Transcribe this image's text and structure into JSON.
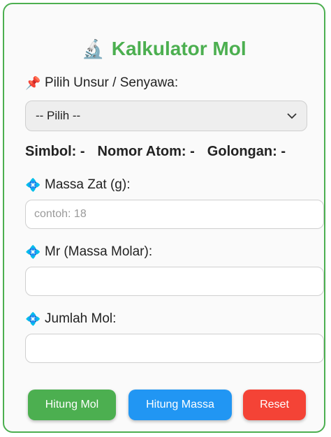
{
  "title": {
    "icon": "microscope-icon",
    "text": "Kalkulator Mol",
    "color": "#4caf50"
  },
  "unsur_label": {
    "icon": "pushpin-icon",
    "text": "Pilih Unsur / Senyawa:"
  },
  "select": {
    "value": "-- Pilih --"
  },
  "info": {
    "simbol": "Simbol: -",
    "nomor_atom": "Nomor Atom: -",
    "golongan": "Golongan: -"
  },
  "massa": {
    "icon": "diamond-icon",
    "label": "Massa Zat (g):",
    "value": "",
    "placeholder": "contoh: 18"
  },
  "mr": {
    "icon": "diamond-icon",
    "label": "Mr (Massa Molar):",
    "value": ""
  },
  "mol": {
    "icon": "diamond-icon",
    "label": "Jumlah Mol:",
    "value": ""
  },
  "buttons": {
    "hitung_mol": "Hitung Mol",
    "hitung_massa": "Hitung Massa",
    "reset": "Reset"
  },
  "colors": {
    "green": "#4caf50",
    "blue": "#2196f3",
    "red": "#f44336"
  }
}
